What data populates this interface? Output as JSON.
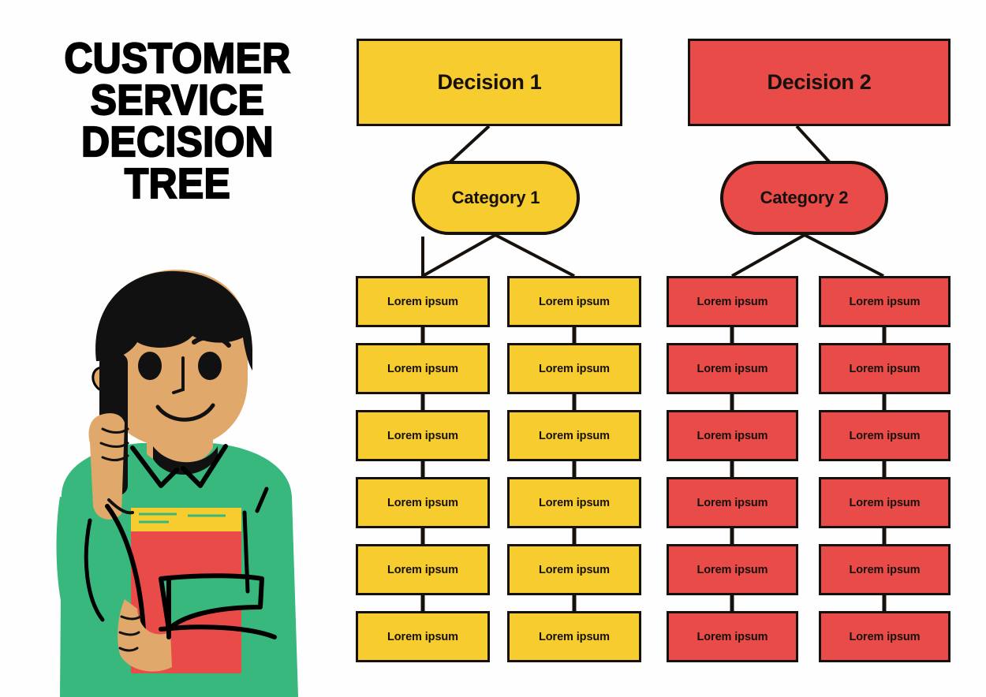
{
  "page": {
    "title_lines": [
      "CUSTOMER",
      "SERVICE",
      "DECISION",
      "TREE"
    ],
    "background_color": "#FEFEFE"
  },
  "colors": {
    "yellow": "#F7CC2E",
    "red": "#E84B48",
    "ink": "#16110C",
    "skin": "#E0A86B",
    "shirt_green": "#38B87C",
    "hair_black": "#111111",
    "book_red": "#E84B48",
    "book_yellow": "#F7CC2E"
  },
  "illustration": {
    "name": "customer-service-agent-on-phone",
    "description": "Flat illustration of a person with black hair wearing a green collared shirt, holding a black phone to the ear and carrying a red book with yellow pages"
  },
  "tree": {
    "branches": [
      {
        "id": "branch-1",
        "color": "yellow",
        "decision": {
          "label": "Decision 1"
        },
        "category": {
          "label": "Category 1"
        },
        "columns": [
          {
            "id": "col-1",
            "leaves": [
              {
                "label": "Lorem ipsum"
              },
              {
                "label": "Lorem ipsum"
              },
              {
                "label": "Lorem ipsum"
              },
              {
                "label": "Lorem ipsum"
              },
              {
                "label": "Lorem ipsum"
              },
              {
                "label": "Lorem ipsum"
              }
            ]
          },
          {
            "id": "col-2",
            "leaves": [
              {
                "label": "Lorem ipsum"
              },
              {
                "label": "Lorem ipsum"
              },
              {
                "label": "Lorem ipsum"
              },
              {
                "label": "Lorem ipsum"
              },
              {
                "label": "Lorem ipsum"
              },
              {
                "label": "Lorem ipsum"
              }
            ]
          }
        ]
      },
      {
        "id": "branch-2",
        "color": "red",
        "decision": {
          "label": "Decision 2"
        },
        "category": {
          "label": "Category 2"
        },
        "columns": [
          {
            "id": "col-3",
            "leaves": [
              {
                "label": "Lorem ipsum"
              },
              {
                "label": "Lorem ipsum"
              },
              {
                "label": "Lorem ipsum"
              },
              {
                "label": "Lorem ipsum"
              },
              {
                "label": "Lorem ipsum"
              },
              {
                "label": "Lorem ipsum"
              }
            ]
          },
          {
            "id": "col-4",
            "leaves": [
              {
                "label": "Lorem ipsum"
              },
              {
                "label": "Lorem ipsum"
              },
              {
                "label": "Lorem ipsum"
              },
              {
                "label": "Lorem ipsum"
              },
              {
                "label": "Lorem ipsum"
              },
              {
                "label": "Lorem ipsum"
              }
            ]
          }
        ]
      }
    ]
  }
}
